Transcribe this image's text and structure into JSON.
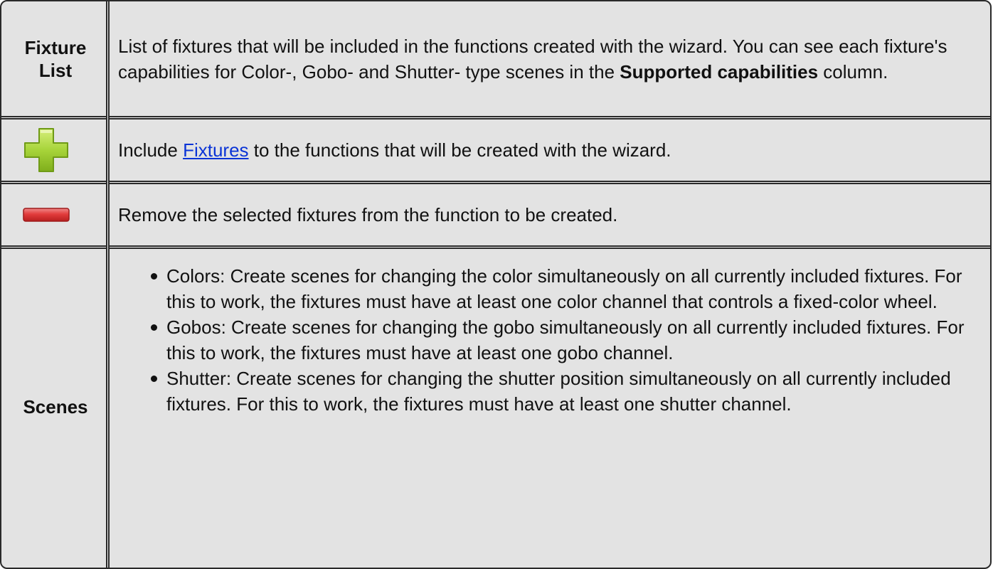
{
  "rows": [
    {
      "label": "Fixture List",
      "text_before": "List of fixtures that will be included in the functions created with the wizard. You can see each fixture's capabilities for Color-, Gobo- and Shutter- type scenes in the ",
      "bold": "Supported capabilities",
      "text_after": " column."
    },
    {
      "icon": "add-icon",
      "text_before": "Include ",
      "link": "Fixtures",
      "text_after": " to the functions that will be created with the wizard."
    },
    {
      "icon": "remove-icon",
      "text": "Remove the selected fixtures from the function to be created."
    },
    {
      "label": "Scenes",
      "items": [
        "Colors: Create scenes for changing the color simultaneously on all currently included fixtures. For this to work, the fixtures must have at least one color channel that controls a fixed-color wheel.",
        "Gobos: Create scenes for changing the gobo simultaneously on all currently included fixtures. For this to work, the fixtures must have at least one gobo channel.",
        "Shutter: Create scenes for changing the shutter position simultaneously on all currently included fixtures. For this to work, the fixtures must have at least one shutter channel."
      ]
    }
  ],
  "colors": {
    "background": "#e3e3e3",
    "border": "#2a2a2a",
    "link": "#0b34d6",
    "add_icon": "#9ccc2c",
    "remove_icon": "#d62f2f"
  }
}
